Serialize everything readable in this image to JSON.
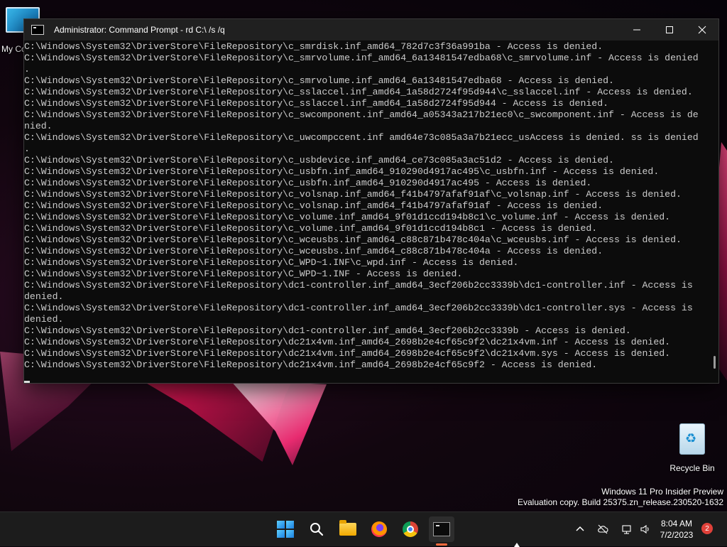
{
  "desktop": {
    "icons": [
      {
        "label": "My Co"
      },
      {
        "label": "Recycle Bin"
      }
    ],
    "watermark": {
      "line1": "Windows 11 Pro Insider Preview",
      "line2": "Evaluation copy. Build 25375.zn_release.230520-1632"
    }
  },
  "window": {
    "title": "Administrator:  Command Prompt - rd  C:\\ /s /q",
    "controls": {
      "minimize": "minimize",
      "maximize": "maximize",
      "close": "close"
    },
    "lines": [
      "C:\\Windows\\System32\\DriverStore\\FileRepository\\c_smrdisk.inf_amd64_782d7c3f36a991ba - Access is denied.",
      "C:\\Windows\\System32\\DriverStore\\FileRepository\\c_smrvolume.inf_amd64_6a13481547edba68\\c_smrvolume.inf - Access is denied",
      ".",
      "C:\\Windows\\System32\\DriverStore\\FileRepository\\c_smrvolume.inf_amd64_6a13481547edba68 - Access is denied.",
      "C:\\Windows\\System32\\DriverStore\\FileRepository\\c_sslaccel.inf_amd64_1a58d2724f95d944\\c_sslaccel.inf - Access is denied.",
      "C:\\Windows\\System32\\DriverStore\\FileRepository\\c_sslaccel.inf_amd64_1a58d2724f95d944 - Access is denied.",
      "C:\\Windows\\System32\\DriverStore\\FileRepository\\c_swcomponent.inf_amd64_a05343a217b21ec0\\c_swcomponent.inf - Access is de",
      "nied.",
      "C:\\Windows\\System32\\DriverStore\\FileRepository\\c_uwcompccent.inf amd64e73c085a3a7b21ecc_usAccess is denied. ss is denied",
      ".",
      "C:\\Windows\\System32\\DriverStore\\FileRepository\\c_usbdevice.inf_amd64_ce73c085a3ac51d2 - Access is denied.",
      "C:\\Windows\\System32\\DriverStore\\FileRepository\\c_usbfn.inf_amd64_910290d4917ac495\\c_usbfn.inf - Access is denied.",
      "C:\\Windows\\System32\\DriverStore\\FileRepository\\c_usbfn.inf_amd64_910290d4917ac495 - Access is denied.",
      "C:\\Windows\\System32\\DriverStore\\FileRepository\\c_volsnap.inf_amd64_f41b4797afaf91af\\c_volsnap.inf - Access is denied.",
      "C:\\Windows\\System32\\DriverStore\\FileRepository\\c_volsnap.inf_amd64_f41b4797afaf91af - Access is denied.",
      "C:\\Windows\\System32\\DriverStore\\FileRepository\\c_volume.inf_amd64_9f01d1ccd194b8c1\\c_volume.inf - Access is denied.",
      "C:\\Windows\\System32\\DriverStore\\FileRepository\\c_volume.inf_amd64_9f01d1ccd194b8c1 - Access is denied.",
      "C:\\Windows\\System32\\DriverStore\\FileRepository\\c_wceusbs.inf_amd64_c88c871b478c404a\\c_wceusbs.inf - Access is denied.",
      "C:\\Windows\\System32\\DriverStore\\FileRepository\\c_wceusbs.inf_amd64_c88c871b478c404a - Access is denied.",
      "C:\\Windows\\System32\\DriverStore\\FileRepository\\C_WPD~1.INF\\c_wpd.inf - Access is denied.",
      "C:\\Windows\\System32\\DriverStore\\FileRepository\\C_WPD~1.INF - Access is denied.",
      "C:\\Windows\\System32\\DriverStore\\FileRepository\\dc1-controller.inf_amd64_3ecf206b2cc3339b\\dc1-controller.inf - Access is",
      "denied.",
      "C:\\Windows\\System32\\DriverStore\\FileRepository\\dc1-controller.inf_amd64_3ecf206b2cc3339b\\dc1-controller.sys - Access is",
      "denied.",
      "C:\\Windows\\System32\\DriverStore\\FileRepository\\dc1-controller.inf_amd64_3ecf206b2cc3339b - Access is denied.",
      "C:\\Windows\\System32\\DriverStore\\FileRepository\\dc21x4vm.inf_amd64_2698b2e4cf65c9f2\\dc21x4vm.inf - Access is denied.",
      "C:\\Windows\\System32\\DriverStore\\FileRepository\\dc21x4vm.inf_amd64_2698b2e4cf65c9f2\\dc21x4vm.sys - Access is denied.",
      "C:\\Windows\\System32\\DriverStore\\FileRepository\\dc21x4vm.inf_amd64_2698b2e4cf65c9f2 - Access is denied."
    ]
  },
  "taskbar": {
    "apps": [
      "start-icon",
      "search-icon",
      "file-explorer-icon",
      "firefox-icon",
      "chrome-icon",
      "terminal-icon"
    ],
    "clock": {
      "time": "8:04 AM",
      "date": "7/2/2023"
    },
    "notification_count": "2",
    "accent": "#ff6a3d"
  }
}
